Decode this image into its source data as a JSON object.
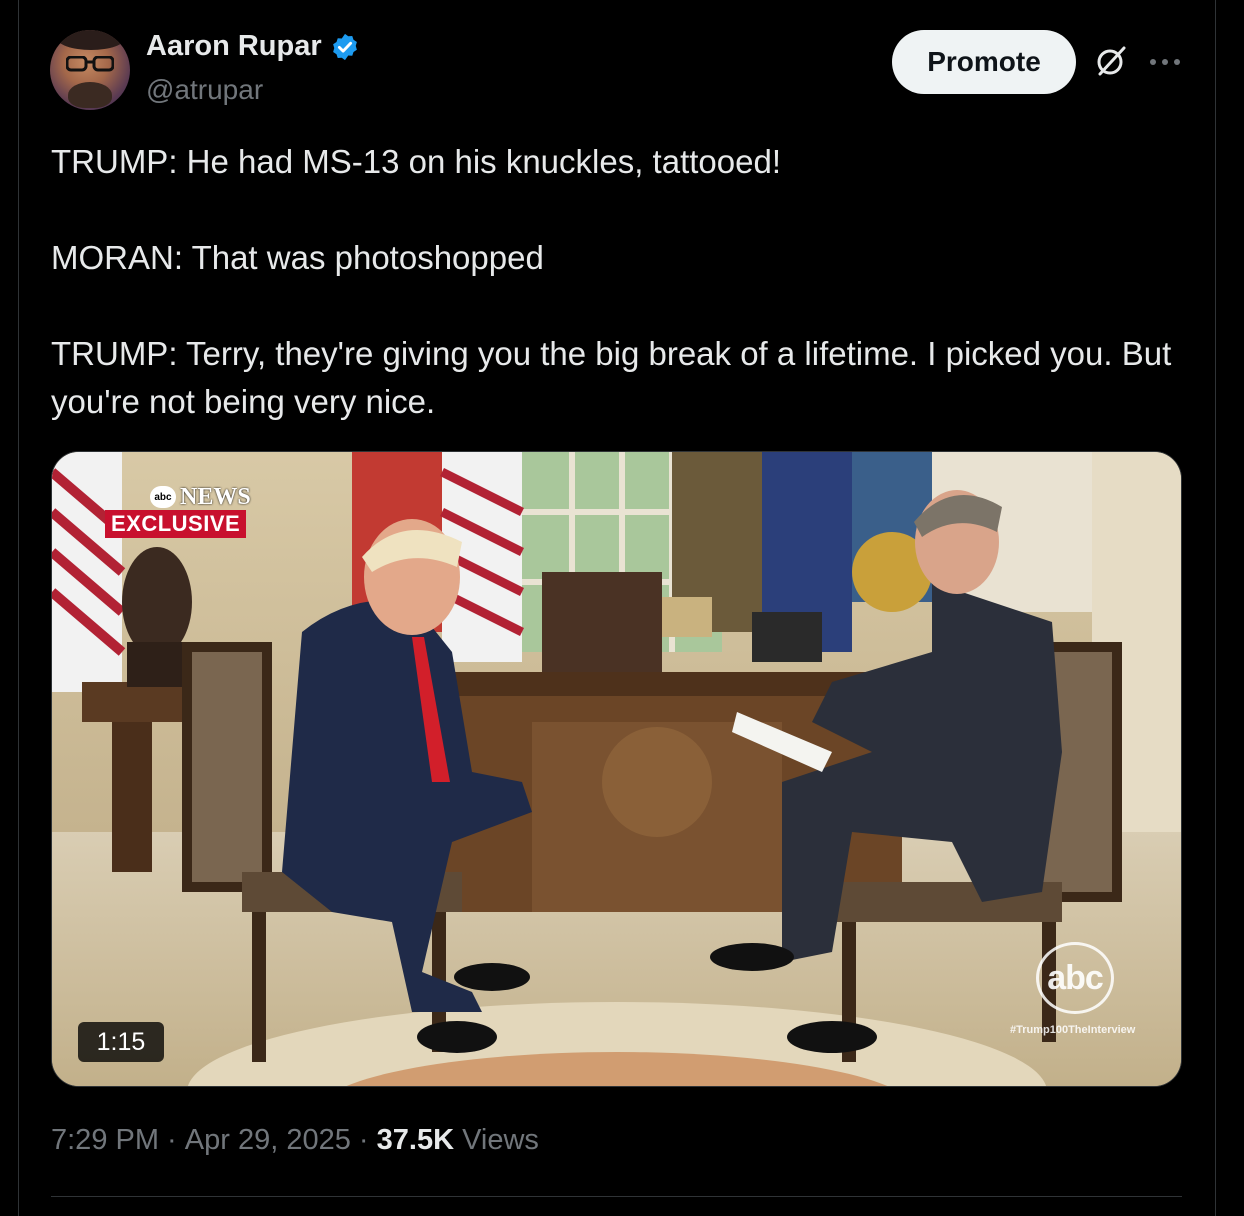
{
  "author": {
    "name": "Aaron Rupar",
    "handle": "@atrupar",
    "verified_color": "#1d9bf0"
  },
  "actions": {
    "promote_label": "Promote",
    "grok_icon": "slashed-circle-icon",
    "more_icon": "more-dots-icon"
  },
  "tweet": {
    "text": "TRUMP: He had MS-13 on his knuckles, tattooed!\n\nMORAN: That was photoshopped\n\nTRUMP: Terry, they're giving you the big break of a lifetime. I picked you. But you're not being very nice."
  },
  "video": {
    "news_label": "NEWS",
    "network_small": "abc",
    "exclusive_label": "EXCLUSIVE",
    "duration": "1:15",
    "watermark": "abc",
    "hashtag": "#Trump100TheInterview"
  },
  "meta": {
    "time": "7:29 PM",
    "separator": " · ",
    "date": "Apr 29, 2025",
    "views_count": "37.5K",
    "views_label": " Views"
  }
}
